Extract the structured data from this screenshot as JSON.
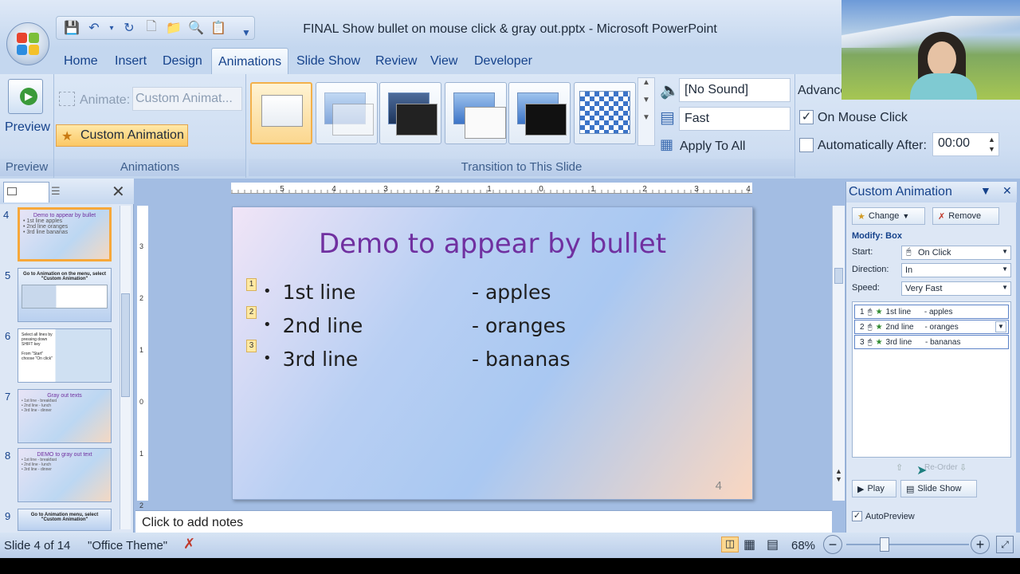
{
  "window": {
    "title": "FINAL Show bullet on mouse click & gray out.pptx - Microsoft PowerPoint"
  },
  "tabs": [
    "Home",
    "Insert",
    "Design",
    "Animations",
    "Slide Show",
    "Review",
    "View",
    "Developer"
  ],
  "active_tab": "Animations",
  "ribbon": {
    "preview": {
      "label": "Preview",
      "group": "Preview"
    },
    "animations": {
      "animate_label": "Animate:",
      "animate_value": "Custom Animat...",
      "custom_animation": "Custom Animation",
      "group": "Animations"
    },
    "transition": {
      "sound": "[No Sound]",
      "speed": "Fast",
      "apply_all": "Apply To All",
      "group": "Transition to This Slide"
    },
    "advance": {
      "label": "Advance",
      "on_mouse_click": "On Mouse Click",
      "on_mouse_click_checked": true,
      "automatically_after": "Automatically After:",
      "automatically_after_checked": false,
      "time": "00:00"
    }
  },
  "thumbnails": [
    {
      "num": "4",
      "title": "Demo to appear by bullet",
      "lines": [
        "• 1st line        apples",
        "• 2nd line       oranges",
        "• 3rd line        bananas"
      ],
      "selected": true
    },
    {
      "num": "5",
      "title": "Go to Animation on the menu, select \"Custom Animation\"",
      "lines": []
    },
    {
      "num": "6",
      "title": "Select all lines by pressing down SHIFT key",
      "lines": [
        "From \"Start\"",
        "choose \"On click\""
      ]
    },
    {
      "num": "7",
      "title": "Gray out texts",
      "lines": [
        "• 1st line      - breakfast",
        "• 2nd line     - lunch",
        "• 3rd line      - dinner"
      ]
    },
    {
      "num": "8",
      "title": "DEMO to gray out text",
      "lines": [
        "• 1st line      - breakfast",
        "• 2nd line     - lunch",
        "• 3rd line      - dinner"
      ]
    },
    {
      "num": "9",
      "title": "Go to Animation menu, select \"Custom Animation\"",
      "lines": []
    }
  ],
  "slide": {
    "title": "Demo to appear by bullet",
    "bullets": [
      {
        "tag": "1",
        "text": "1st line",
        "fruit": "- apples"
      },
      {
        "tag": "2",
        "text": "2nd line",
        "fruit": "- oranges"
      },
      {
        "tag": "3",
        "text": "3rd line",
        "fruit": "- bananas"
      }
    ],
    "number": "4"
  },
  "notes_placeholder": "Click to add notes",
  "custom_animation_pane": {
    "title": "Custom Animation",
    "change": "Change",
    "remove": "Remove",
    "modify": "Modify: Box",
    "start_label": "Start:",
    "start_value": "On Click",
    "direction_label": "Direction:",
    "direction_value": "In",
    "speed_label": "Speed:",
    "speed_value": "Very Fast",
    "items": [
      {
        "num": "1",
        "text": "1st line      - apples"
      },
      {
        "num": "2",
        "text": "2nd line     - oranges"
      },
      {
        "num": "3",
        "text": "3rd line      - bananas"
      }
    ],
    "reorder": "Re-Order",
    "play": "Play",
    "slide_show": "Slide Show",
    "autopreview": "AutoPreview",
    "autopreview_checked": true
  },
  "status": {
    "slide": "Slide 4 of 14",
    "theme": "\"Office Theme\"",
    "zoom": "68%"
  },
  "ruler": {
    "h_ticks": [
      "5",
      "4",
      "3",
      "2",
      "1",
      "0",
      "1",
      "2",
      "3",
      "4"
    ],
    "v_ticks": [
      "3",
      "2",
      "1",
      "0",
      "1",
      "2"
    ]
  }
}
